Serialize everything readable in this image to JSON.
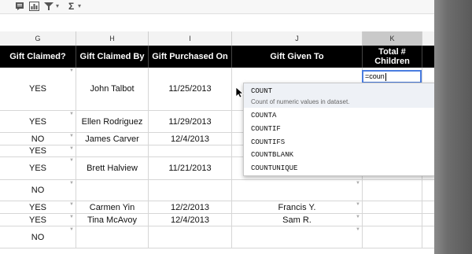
{
  "toolbar": {
    "icons": [
      "comment-icon",
      "chart-icon",
      "filter-icon",
      "functions-icon"
    ],
    "sigma_symbol": "Σ",
    "dropdown_arrow": "▾"
  },
  "columns": [
    "G",
    "H",
    "I",
    "J",
    "K"
  ],
  "headers": {
    "g": "Gift Claimed?",
    "h": "Gift Claimed By",
    "i": "Gift Purchased On",
    "j": "Gift Given To",
    "k_line1": "Total #",
    "k_line2": "Children"
  },
  "rows": [
    {
      "g": "YES",
      "h": "John Talbot",
      "i": "11/25/2013",
      "j": "",
      "k": ""
    },
    {
      "g": "YES",
      "h": "Ellen Rodriguez",
      "i": "11/29/2013",
      "j": "",
      "k": ""
    },
    {
      "g": "NO",
      "h": "James Carver",
      "i": "12/4/2013",
      "j": "",
      "k": ""
    },
    {
      "g": "YES",
      "h": "",
      "i": "",
      "j": "",
      "k": ""
    },
    {
      "g": "YES",
      "h": "Brett Halview",
      "i": "11/21/2013",
      "j": "",
      "k": ""
    },
    {
      "g": "NO",
      "h": "",
      "i": "",
      "j": "",
      "k": ""
    },
    {
      "g": "YES",
      "h": "Carmen Yin",
      "i": "12/2/2013",
      "j": "Francis Y.",
      "k": ""
    },
    {
      "g": "YES",
      "h": "Tina McAvoy",
      "i": "12/4/2013",
      "j": "Sam R.",
      "k": ""
    },
    {
      "g": "NO",
      "h": "",
      "i": "",
      "j": "",
      "k": ""
    }
  ],
  "active_cell": {
    "value": "=coun"
  },
  "autocomplete": {
    "items": [
      {
        "name": "COUNT",
        "description": "Count of numeric values in dataset."
      },
      {
        "name": "COUNTA"
      },
      {
        "name": "COUNTIF"
      },
      {
        "name": "COUNTIFS"
      },
      {
        "name": "COUNTBLANK"
      },
      {
        "name": "COUNTUNIQUE"
      }
    ]
  },
  "colors": {
    "header_bg": "#000000",
    "header_text": "#ffffff",
    "selection_border": "#4a7de0"
  }
}
